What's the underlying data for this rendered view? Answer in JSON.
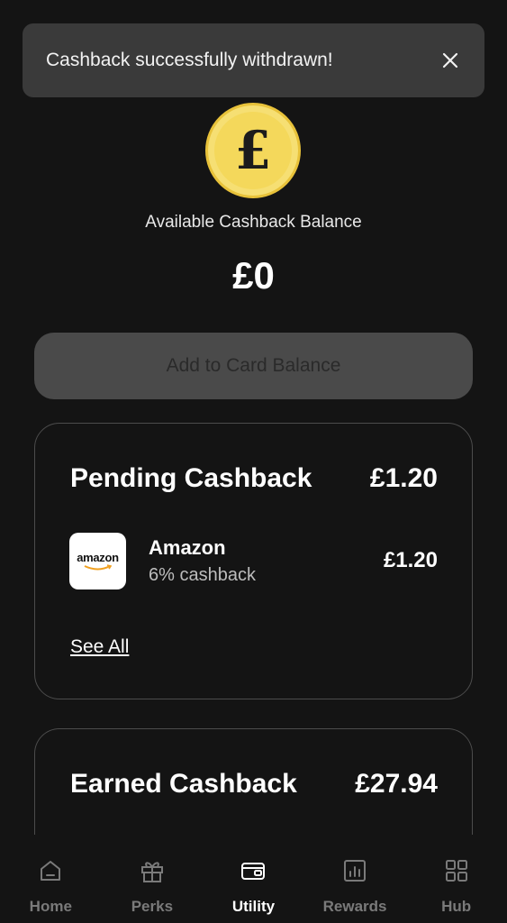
{
  "toast": {
    "message": "Cashback successfully withdrawn!",
    "close_icon": "close-icon"
  },
  "balance": {
    "coin_icon": "pound-coin-icon",
    "coin_symbol": "£",
    "label": "Available Cashback Balance",
    "amount": "£0"
  },
  "add_button": {
    "label": "Add to Card Balance"
  },
  "pending": {
    "title": "Pending Cashback",
    "total": "£1.20",
    "items": [
      {
        "logo_text": "amazon",
        "name": "Amazon",
        "rate": "6% cashback",
        "amount": "£1.20"
      }
    ],
    "see_all": "See All"
  },
  "earned": {
    "title": "Earned Cashback",
    "total": "£27.94"
  },
  "nav": {
    "items": [
      {
        "label": "Home",
        "icon": "home-icon",
        "active": false
      },
      {
        "label": "Perks",
        "icon": "gift-icon",
        "active": false
      },
      {
        "label": "Utility",
        "icon": "wallet-icon",
        "active": true
      },
      {
        "label": "Rewards",
        "icon": "chart-icon",
        "active": false
      },
      {
        "label": "Hub",
        "icon": "grid-icon",
        "active": false
      }
    ]
  },
  "colors": {
    "background": "#141414",
    "coin": "#f4d85b",
    "toast": "#3a3a3a",
    "inactive_nav": "#7a7a7a"
  }
}
